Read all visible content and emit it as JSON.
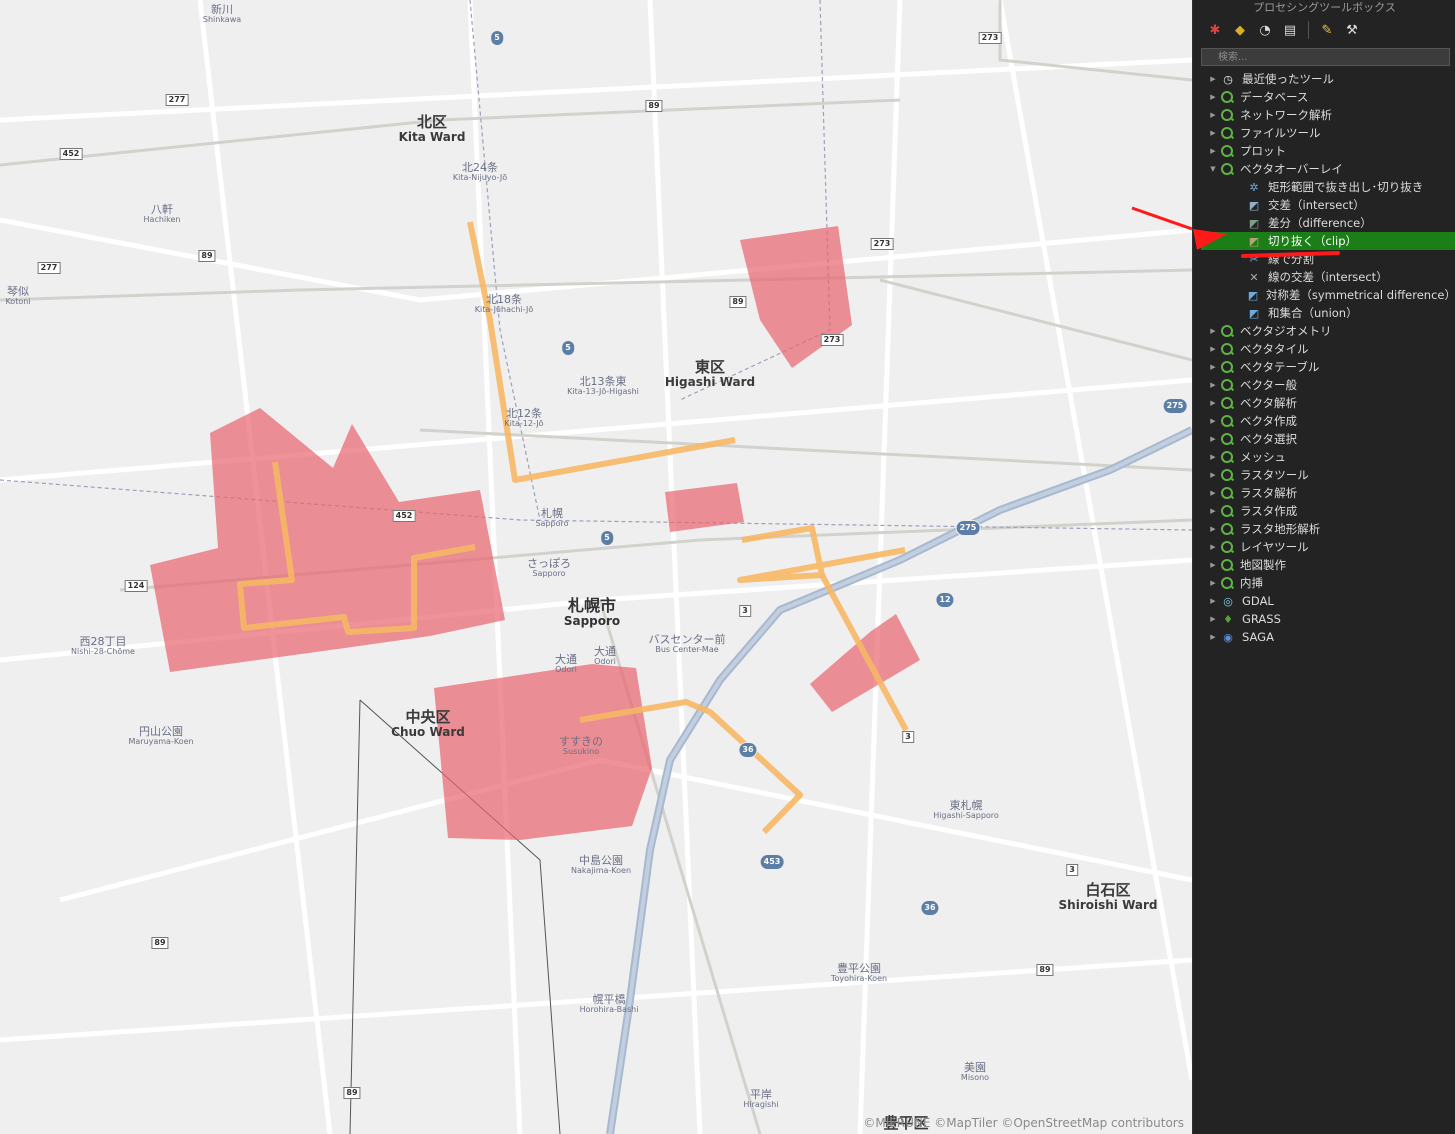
{
  "map": {
    "credit": "©MIERUNE ©MapTiler ©OpenStreetMap contributors",
    "wards": [
      {
        "ja": "北区",
        "en": "Kita Ward"
      },
      {
        "ja": "東区",
        "en": "Higashi Ward"
      },
      {
        "ja": "中央区",
        "en": "Chuo Ward"
      },
      {
        "ja": "白石区",
        "en": "Shiroishi Ward"
      },
      {
        "ja": "豊平区",
        "en": ""
      }
    ],
    "city": {
      "ja": "札幌市",
      "en": "Sapporo"
    },
    "stations": [
      {
        "ja": "新川",
        "en": "Shinkawa"
      },
      {
        "ja": "八軒",
        "en": "Hachiken"
      },
      {
        "ja": "琴似",
        "en": "Kotoni"
      },
      {
        "ja": "北24条",
        "en": "Kita-Nijuyo-Jō"
      },
      {
        "ja": "北18条",
        "en": "Kita-Jūhachi-Jō"
      },
      {
        "ja": "北13条東",
        "en": "Kita-13-Jō-Higashi"
      },
      {
        "ja": "北12条",
        "en": "Kita-12-Jō"
      },
      {
        "ja": "札幌",
        "en": "Sapporo"
      },
      {
        "ja": "さっぽろ",
        "en": "Sapporo"
      },
      {
        "ja": "西28丁目",
        "en": "Nishi-28-Chōme"
      },
      {
        "ja": "大通",
        "en": "Odori"
      },
      {
        "ja": "大通",
        "en": "Odori"
      },
      {
        "ja": "バスセンター前",
        "en": "Bus Center-Mae"
      },
      {
        "ja": "円山公園",
        "en": "Maruyama-Koen"
      },
      {
        "ja": "すすきの",
        "en": "Susukino"
      },
      {
        "ja": "中島公園",
        "en": "Nakajima-Koen"
      },
      {
        "ja": "東札幌",
        "en": "Higashi-Sapporo"
      },
      {
        "ja": "豊平公園",
        "en": "Toyohira-Koen"
      },
      {
        "ja": "幌平橋",
        "en": "Horohira-Bashi"
      },
      {
        "ja": "美園",
        "en": "Misono"
      },
      {
        "ja": "平岸",
        "en": "Hiragishi"
      }
    ],
    "shields": [
      "5",
      "277",
      "452",
      "89",
      "277",
      "89",
      "273",
      "273",
      "89",
      "273",
      "5",
      "275",
      "275",
      "452",
      "124",
      "5",
      "3",
      "12",
      "3",
      "36",
      "453",
      "36",
      "3",
      "89",
      "89",
      "89"
    ],
    "colors": {
      "polygon_fill": "#e8646e",
      "line_stroke": "#f6b765",
      "map_bg": "#efefef"
    }
  },
  "panel": {
    "title": "プロセシングツールボックス",
    "search_placeholder": "検索...",
    "toolbar": [
      {
        "name": "models-icon",
        "glyph": "✱"
      },
      {
        "name": "python-icon",
        "glyph": "◆"
      },
      {
        "name": "history-icon",
        "glyph": "◔"
      },
      {
        "name": "results-icon",
        "glyph": "▤"
      },
      {
        "name": "edit-features-icon",
        "glyph": "✎"
      },
      {
        "name": "options-wrench-icon",
        "glyph": "⚒"
      }
    ],
    "tree": [
      {
        "label": "最近使ったツール",
        "level": 0,
        "expanded": false,
        "icon": "clock-icon"
      },
      {
        "label": "データベース",
        "level": 0,
        "expanded": false,
        "icon": "qgis-icon"
      },
      {
        "label": "ネットワーク解析",
        "level": 0,
        "expanded": false,
        "icon": "qgis-icon"
      },
      {
        "label": "ファイルツール",
        "level": 0,
        "expanded": false,
        "icon": "qgis-icon"
      },
      {
        "label": "プロット",
        "level": 0,
        "expanded": false,
        "icon": "qgis-icon"
      },
      {
        "label": "ベクタオーバーレイ",
        "level": 0,
        "expanded": true,
        "icon": "qgis-icon"
      },
      {
        "label": "矩形範囲で抜き出し･切り抜き",
        "level": 1,
        "icon": "gear-icon"
      },
      {
        "label": "交差（intersect）",
        "level": 1,
        "icon": "intersect-icon"
      },
      {
        "label": "差分（difference）",
        "level": 1,
        "icon": "difference-icon"
      },
      {
        "label": "切り抜く（clip）",
        "level": 1,
        "icon": "clip-icon",
        "selected": true
      },
      {
        "label": "線で分割",
        "level": 1,
        "icon": "split-icon"
      },
      {
        "label": "線の交差（intersect）",
        "level": 1,
        "icon": "line-intersect-icon"
      },
      {
        "label": "対称差（symmetrical difference）",
        "level": 1,
        "icon": "symdiff-icon"
      },
      {
        "label": "和集合（union）",
        "level": 1,
        "icon": "union-icon"
      },
      {
        "label": "ベクタジオメトリ",
        "level": 0,
        "expanded": false,
        "icon": "qgis-icon"
      },
      {
        "label": "ベクタタイル",
        "level": 0,
        "expanded": false,
        "icon": "qgis-icon"
      },
      {
        "label": "ベクタテーブル",
        "level": 0,
        "expanded": false,
        "icon": "qgis-icon"
      },
      {
        "label": "ベクター般",
        "level": 0,
        "expanded": false,
        "icon": "qgis-icon"
      },
      {
        "label": "ベクタ解析",
        "level": 0,
        "expanded": false,
        "icon": "qgis-icon"
      },
      {
        "label": "ベクタ作成",
        "level": 0,
        "expanded": false,
        "icon": "qgis-icon"
      },
      {
        "label": "ベクタ選択",
        "level": 0,
        "expanded": false,
        "icon": "qgis-icon"
      },
      {
        "label": "メッシュ",
        "level": 0,
        "expanded": false,
        "icon": "qgis-icon"
      },
      {
        "label": "ラスタツール",
        "level": 0,
        "expanded": false,
        "icon": "qgis-icon"
      },
      {
        "label": "ラスタ解析",
        "level": 0,
        "expanded": false,
        "icon": "qgis-icon"
      },
      {
        "label": "ラスタ作成",
        "level": 0,
        "expanded": false,
        "icon": "qgis-icon"
      },
      {
        "label": "ラスタ地形解析",
        "level": 0,
        "expanded": false,
        "icon": "qgis-icon"
      },
      {
        "label": "レイヤツール",
        "level": 0,
        "expanded": false,
        "icon": "qgis-icon"
      },
      {
        "label": "地図製作",
        "level": 0,
        "expanded": false,
        "icon": "qgis-icon"
      },
      {
        "label": "内挿",
        "level": 0,
        "expanded": false,
        "icon": "qgis-icon"
      },
      {
        "label": "GDAL",
        "level": 0,
        "expanded": false,
        "icon": "gdal-icon"
      },
      {
        "label": "GRASS",
        "level": 0,
        "expanded": false,
        "icon": "grass-icon"
      },
      {
        "label": "SAGA",
        "level": 0,
        "expanded": false,
        "icon": "saga-icon"
      }
    ]
  }
}
